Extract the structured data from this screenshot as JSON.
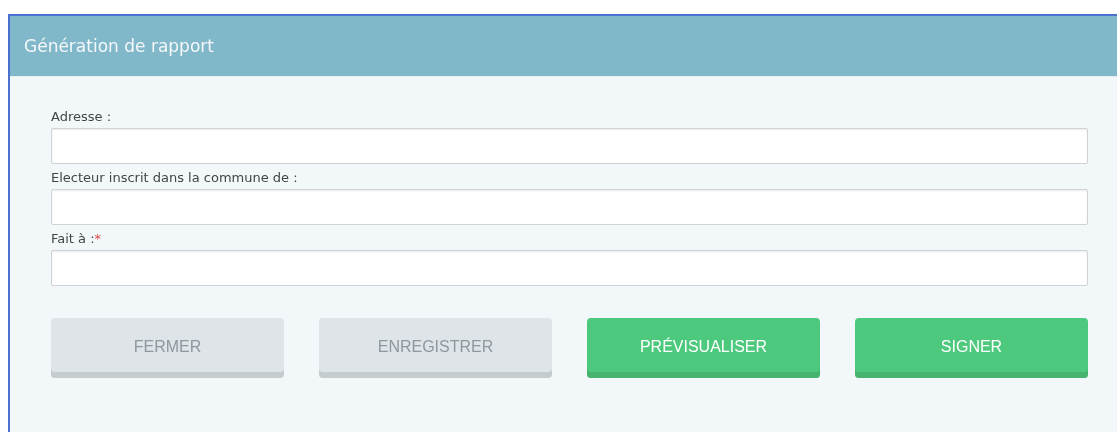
{
  "dialog": {
    "title": "Génération de rapport"
  },
  "fields": [
    {
      "label": "Adresse :"
    },
    {
      "label": "Electeur inscrit dans la commune de :"
    },
    {
      "label": "Fait à :",
      "required_marker": "*"
    }
  ],
  "buttons": [
    {
      "label": "FERMER",
      "kind": "secondary"
    },
    {
      "label": "ENREGISTRER",
      "kind": "secondary"
    },
    {
      "label": "PRÉVISUALISER",
      "kind": "primary"
    },
    {
      "label": "SIGNER",
      "kind": "primary"
    }
  ]
}
